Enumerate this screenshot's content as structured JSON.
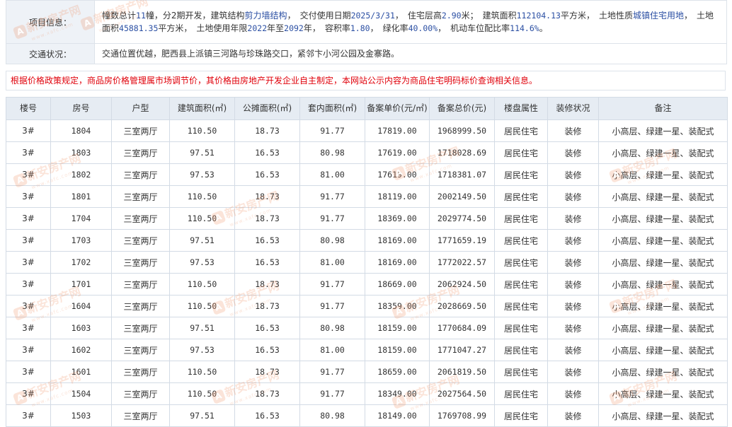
{
  "project": {
    "label": "项目信息：",
    "seg": {
      "bld_pre": "幢数总计",
      "bld_num": "11",
      "bld_suf": "幢",
      "phase": "，分2期开发，",
      "struct_pre": "建筑结构",
      "struct_val": "剪力墙结构",
      "deliver_pre": "，　交付使用日期",
      "deliver_val": "2025/3/31",
      "height_pre": "，　住宅层高",
      "height_val": "2.90",
      "height_suf": "米；　建筑面积",
      "area_val": "112104.13",
      "area_suf": "平方米，　土地性质",
      "land_val": "城镇住宅用地",
      "landarea_pre": "，　土地面积",
      "landarea_val": "45881.35",
      "landarea_suf": "平方米，　土地使用年限",
      "year_from": "2022",
      "year_mid": "年至",
      "year_to": "2092",
      "year_suf": "年，　容积率",
      "far_val": "1.80",
      "green_pre": "，　绿化率",
      "green_val": "40.00%",
      "park_pre": "，　机动车位配比率",
      "park_val": "114.6%",
      "end": "。"
    },
    "traffic_label": "交通状况：",
    "traffic_text": "交通位置优越，肥西县上派镇三河路与珍珠路交口，紧邻卞小河公园及金寨路。"
  },
  "notice": "根据价格政策规定，商品房价格管理属市场调节价，其价格由房地产开发企业自主制定，本网站公示内容为商品住宅明码标价查询相关信息。",
  "columns": [
    "楼号",
    "房号",
    "户型",
    "建筑面积(㎡)",
    "公摊面积(㎡)",
    "套内面积(㎡)",
    "备案单价(元/㎡)",
    "备案总价(元)",
    "楼盘属性",
    "装修状况",
    "备注"
  ],
  "rows": [
    [
      "3#",
      "1804",
      "三室两厅",
      "110.50",
      "18.73",
      "91.77",
      "17819.00",
      "1968999.50",
      "居民住宅",
      "装修",
      "小高层、绿建一星、装配式"
    ],
    [
      "3#",
      "1803",
      "三室两厅",
      "97.51",
      "16.53",
      "80.98",
      "17619.00",
      "1718028.69",
      "居民住宅",
      "装修",
      "小高层、绿建一星、装配式"
    ],
    [
      "3#",
      "1802",
      "三室两厅",
      "97.53",
      "16.53",
      "81.00",
      "17619.00",
      "1718381.07",
      "居民住宅",
      "装修",
      "小高层、绿建一星、装配式"
    ],
    [
      "3#",
      "1801",
      "三室两厅",
      "110.50",
      "18.73",
      "91.77",
      "18119.00",
      "2002149.50",
      "居民住宅",
      "装修",
      "小高层、绿建一星、装配式"
    ],
    [
      "3#",
      "1704",
      "三室两厅",
      "110.50",
      "18.73",
      "91.77",
      "18369.00",
      "2029774.50",
      "居民住宅",
      "装修",
      "小高层、绿建一星、装配式"
    ],
    [
      "3#",
      "1703",
      "三室两厅",
      "97.51",
      "16.53",
      "80.98",
      "18169.00",
      "1771659.19",
      "居民住宅",
      "装修",
      "小高层、绿建一星、装配式"
    ],
    [
      "3#",
      "1702",
      "三室两厅",
      "97.53",
      "16.53",
      "81.00",
      "18169.00",
      "1772022.57",
      "居民住宅",
      "装修",
      "小高层、绿建一星、装配式"
    ],
    [
      "3#",
      "1701",
      "三室两厅",
      "110.50",
      "18.73",
      "91.77",
      "18669.00",
      "2062924.50",
      "居民住宅",
      "装修",
      "小高层、绿建一星、装配式"
    ],
    [
      "3#",
      "1604",
      "三室两厅",
      "110.50",
      "18.73",
      "91.77",
      "18359.00",
      "2028669.50",
      "居民住宅",
      "装修",
      "小高层、绿建一星、装配式"
    ],
    [
      "3#",
      "1603",
      "三室两厅",
      "97.51",
      "16.53",
      "80.98",
      "18159.00",
      "1770684.09",
      "居民住宅",
      "装修",
      "小高层、绿建一星、装配式"
    ],
    [
      "3#",
      "1602",
      "三室两厅",
      "97.53",
      "16.53",
      "81.00",
      "18159.00",
      "1771047.27",
      "居民住宅",
      "装修",
      "小高层、绿建一星、装配式"
    ],
    [
      "3#",
      "1601",
      "三室两厅",
      "110.50",
      "18.73",
      "91.77",
      "18659.00",
      "2061819.50",
      "居民住宅",
      "装修",
      "小高层、绿建一星、装配式"
    ],
    [
      "3#",
      "1504",
      "三室两厅",
      "110.50",
      "18.73",
      "91.77",
      "18349.00",
      "2027564.50",
      "居民住宅",
      "装修",
      "小高层、绿建一星、装配式"
    ],
    [
      "3#",
      "1503",
      "三室两厅",
      "97.51",
      "16.53",
      "80.98",
      "18149.00",
      "1769708.99",
      "居民住宅",
      "装修",
      "小高层、绿建一星、装配式"
    ]
  ],
  "watermark": {
    "text": "新安房产网",
    "logo": "A",
    "sub": "www.xafc.com"
  },
  "colors": {
    "link": "#2b4fa3",
    "notice": "#e0000a",
    "header_bg": "#e6ecf3",
    "label_bg": "#eef2f7",
    "border": "#d3dbe5"
  }
}
